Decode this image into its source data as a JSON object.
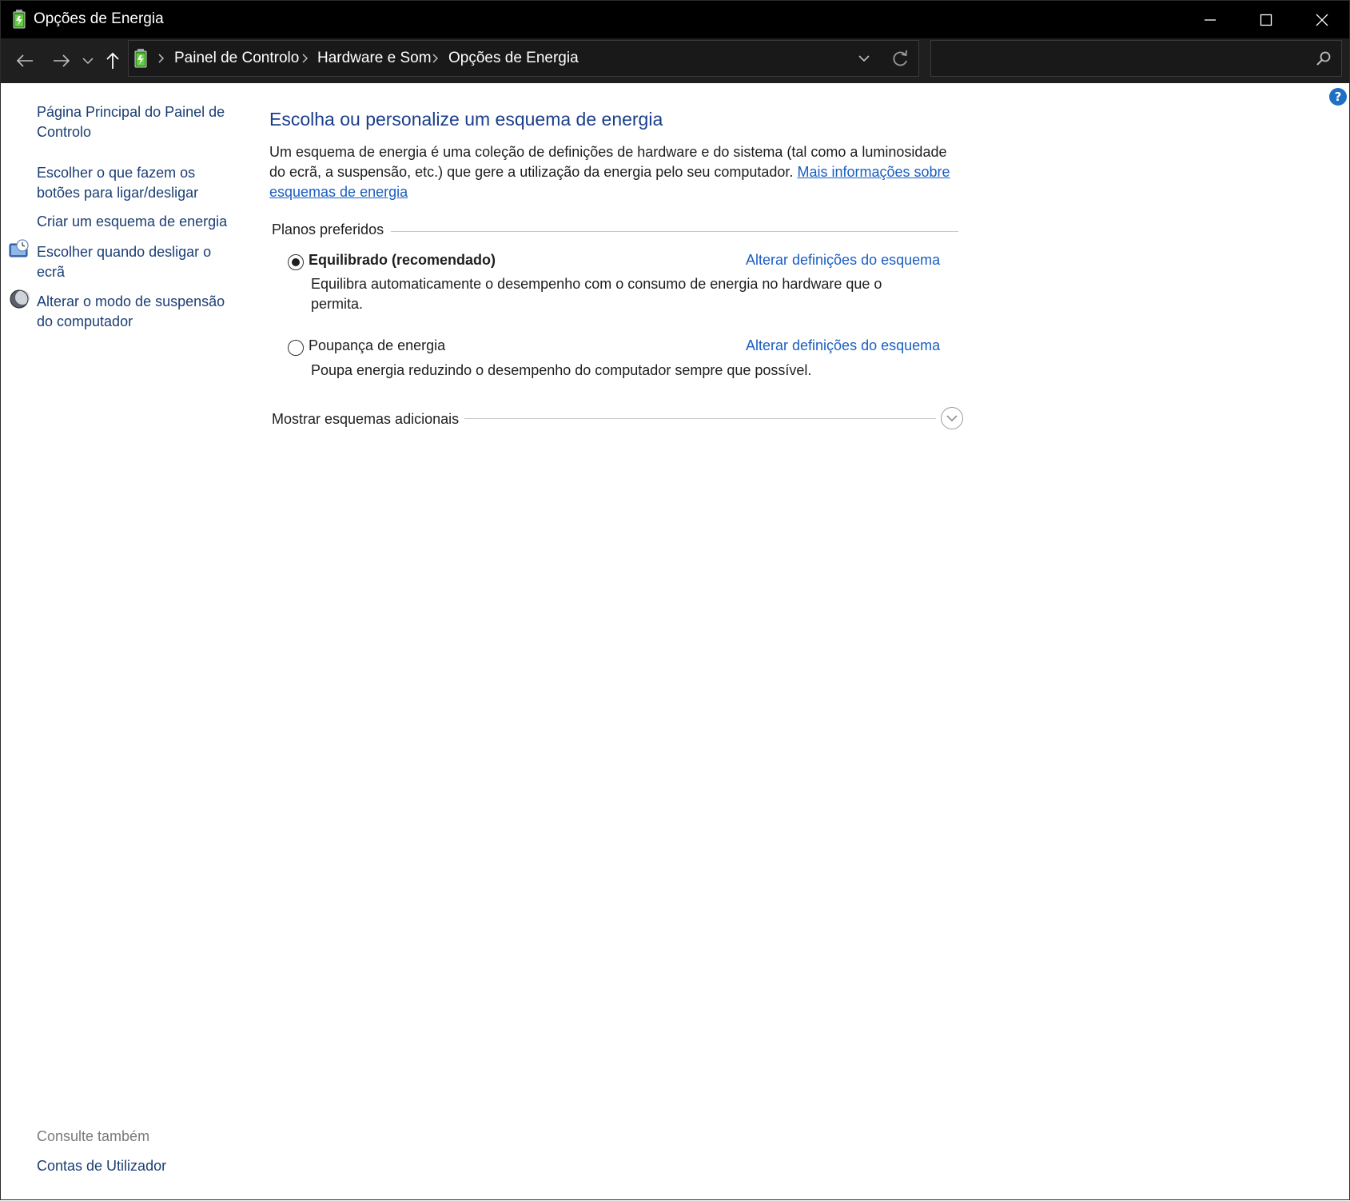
{
  "window": {
    "title": "Opções de Energia"
  },
  "address_bar": {
    "breadcrumbs": [
      "Painel de Controlo",
      "Hardware e Som",
      "Opções de Energia"
    ],
    "search_placeholder": ""
  },
  "left_pane": {
    "home_link": "Página Principal do Painel de Controlo",
    "links": [
      "Escolher o que fazem os botões para ligar/desligar",
      "Criar um esquema de energia",
      "Escolher quando desligar o ecrã",
      "Alterar o modo de suspensão do computador"
    ],
    "see_also_label": "Consulte também",
    "see_also_links": [
      "Contas de Utilizador"
    ]
  },
  "main": {
    "heading": "Escolha ou personalize um esquema de energia",
    "intro_text": "Um esquema de energia é uma coleção de definições de hardware e do sistema (tal como a luminosidade do ecrã, a suspensão, etc.) que gere a utilização da energia pelo seu computador.",
    "intro_link": "Mais informações sobre esquemas de energia",
    "preferred_title": "Planos preferidos",
    "plans": [
      {
        "name": "Equilibrado (recomendado)",
        "selected": true,
        "link": "Alterar definições do esquema",
        "description": "Equilibra automaticamente o desempenho com o consumo de energia no hardware que o permita."
      },
      {
        "name": "Poupança de energia",
        "selected": false,
        "link": "Alterar definições do esquema",
        "description": "Poupa energia reduzindo o desempenho do computador sempre que possível."
      }
    ],
    "additional_title": "Mostrar esquemas adicionais"
  },
  "help": {
    "label": "?"
  },
  "colors": {
    "titlebar": "#000000",
    "navbar": "#1f1f1f",
    "heading_blue": "#1a3e8c",
    "link_blue": "#1a5ec2",
    "left_link": "#1a3e73",
    "help_blue": "#1f6fc4"
  }
}
